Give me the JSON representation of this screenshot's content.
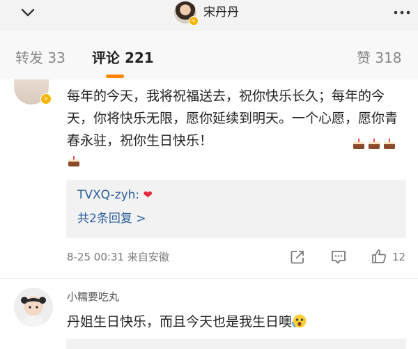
{
  "header": {
    "back_icon": "chevron-down-icon",
    "user_name": "宋丹丹",
    "more_icon": "more-dots-icon"
  },
  "tabs": [
    {
      "label": "转发",
      "count": "33",
      "active": false
    },
    {
      "label": "评论",
      "count": "221",
      "active": true
    },
    {
      "label": "赞",
      "count": "318",
      "active": false
    }
  ],
  "comment1": {
    "text": "每年的今天，我将祝福送去，祝你快乐长久；每年的今天，你将快乐无限，愿你延续到明天。一个心愿，愿你青春永驻，祝你生日快乐！",
    "reply_user": "TVXQ-zyh:",
    "reply_icon": "heart-icon",
    "reply_more": "共2条回复 >",
    "time": "8-25 00:31",
    "location": "来自安徽",
    "like_count": "12"
  },
  "comment2": {
    "user": "小糯要吃丸",
    "text": "丹姐生日快乐，而且今天也是我生日噢"
  },
  "colors": {
    "accent": "#ff8200",
    "link": "#2c5f9e",
    "heart": "#e8263a",
    "verified": "#f5b500"
  }
}
